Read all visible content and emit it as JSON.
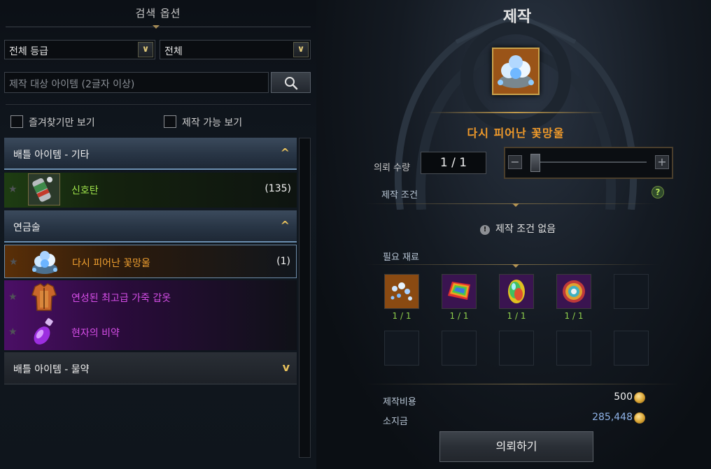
{
  "search_panel": {
    "title": "검색 옵션",
    "grade_dropdown": "전체 등급",
    "type_dropdown": "전체",
    "search_placeholder": "제작 대상 아이템 (2글자 이상)",
    "favorites_only": "즐겨찾기만 보기",
    "craftable_only": "제작 가능 보기"
  },
  "list": {
    "categories": [
      {
        "label": "배틀 아이템 - 기타",
        "expanded": true,
        "chevron": "^"
      },
      {
        "label": "연금술",
        "expanded": true,
        "chevron": "^"
      },
      {
        "label": "배틀 아이템 - 물약",
        "expanded": false,
        "chevron": "v"
      }
    ],
    "items": [
      {
        "name": "신호탄",
        "count": "(135)",
        "grade_color": "#9fe34a",
        "icon": "signal-flare-icon"
      },
      {
        "name": "다시 피어난 꽃망울",
        "count": "(1)",
        "grade_color": "#f0a030",
        "icon": "blue-flower-icon"
      },
      {
        "name": "연성된 최고급 가죽 갑옷",
        "count": "",
        "grade_color": "#d64ee8",
        "icon": "leather-armor-icon"
      },
      {
        "name": "현자의 비약",
        "count": "",
        "grade_color": "#d64ee8",
        "icon": "purple-potion-icon"
      }
    ]
  },
  "craft": {
    "title": "제작",
    "item_name": "다시 피어난 꽃망울",
    "item_icon": "blue-flower-icon",
    "quantity_label": "의뢰 수량",
    "quantity_value": "1 / 1",
    "slider_minus": "−",
    "slider_plus": "+",
    "condition_label": "제작 조건",
    "help_glyph": "?",
    "info_glyph": "!",
    "no_condition": "제작 조건 없음",
    "materials_label": "필요 재료",
    "materials": [
      {
        "icon": "blue-crystal-shards-icon",
        "count": "1 / 1"
      },
      {
        "icon": "rainbow-fabric-icon",
        "count": "1 / 1"
      },
      {
        "icon": "rainbow-gem-icon",
        "count": "1 / 1"
      },
      {
        "icon": "rainbow-orb-icon",
        "count": "1 / 1"
      }
    ],
    "cost_label": "제작비용",
    "cost_value": "500",
    "owned_label": "소지금",
    "owned_value": "285,448",
    "button_label": "의뢰하기"
  },
  "colors": {
    "accent_gold": "#c9a24c",
    "owned_value": "#8fb3e8",
    "material_count": "#8fd04c"
  }
}
